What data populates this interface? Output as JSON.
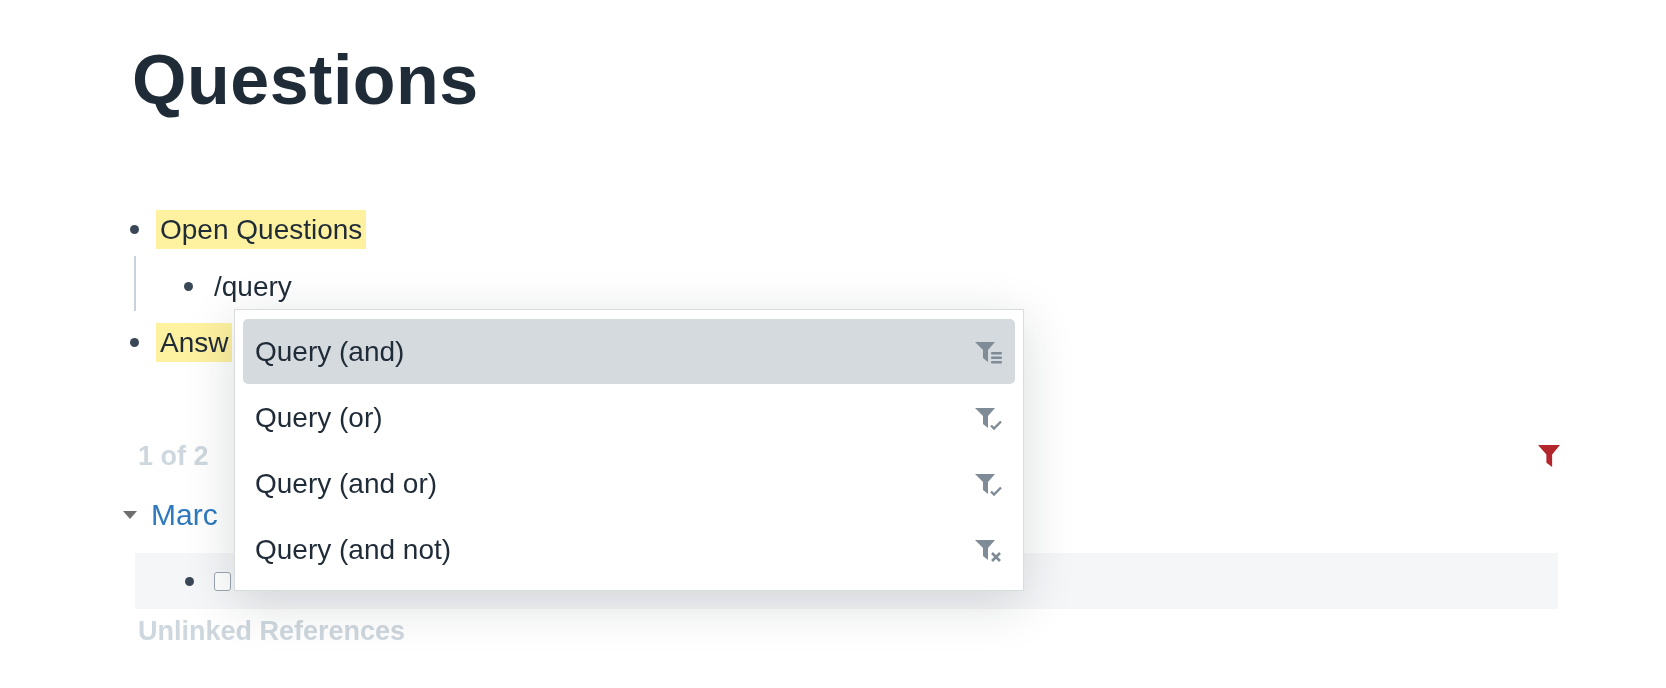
{
  "page": {
    "title": "Questions"
  },
  "blocks": [
    {
      "text": "Open Questions",
      "highlighted": true,
      "children": [
        {
          "text": "/query",
          "highlighted": false
        }
      ]
    },
    {
      "text": "Answ",
      "highlighted": true
    }
  ],
  "references": {
    "count": "1 of 2",
    "filter_active": true,
    "groups": [
      {
        "page": "Marc",
        "expanded": true,
        "blocks": [
          {
            "checked": false
          }
        ]
      }
    ]
  },
  "unlinked": {
    "title": "Unlinked References"
  },
  "menu": {
    "items": [
      {
        "label": "Query (and)",
        "kind": "and",
        "selected": true
      },
      {
        "label": "Query (or)",
        "kind": "or",
        "selected": false
      },
      {
        "label": "Query (and or)",
        "kind": "andor",
        "selected": false
      },
      {
        "label": "Query (and not)",
        "kind": "not",
        "selected": false
      }
    ]
  }
}
